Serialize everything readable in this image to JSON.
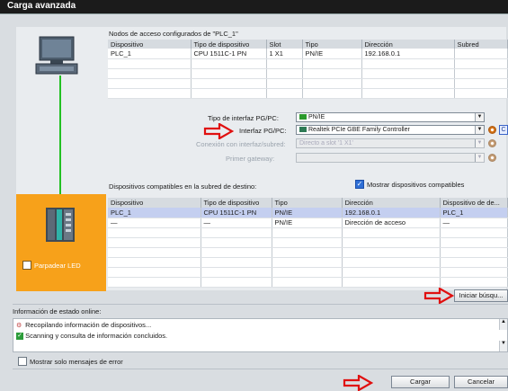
{
  "window": {
    "title": "Carga avanzada"
  },
  "configured": {
    "caption": "Nodos de acceso configurados de \"PLC_1\"",
    "columns": [
      "Dispositivo",
      "Tipo de dispositivo",
      "Slot",
      "Tipo",
      "Dirección",
      "Subred"
    ],
    "rows": [
      [
        "PLC_1",
        "CPU 1511C-1 PN",
        "1 X1",
        "PN/IE",
        "192.168.0.1",
        ""
      ]
    ]
  },
  "interface": {
    "type_label": "Tipo de interfaz PG/PC:",
    "type_value": "PN/IE",
    "iface_label": "Interfaz PG/PC:",
    "iface_value": "Realtek PCIe GBE Family Controller",
    "iface_extra": "C",
    "conn_label": "Conexión con interfaz/subred:",
    "conn_value": "Directo a slot '1 X1'",
    "gateway_label": "Primer gateway:",
    "gateway_value": ""
  },
  "compatible": {
    "caption": "Dispositivos compatibles en la subred de destino:",
    "show_all_label": "Mostrar dispositivos compatibles",
    "show_all_checked": true,
    "columns": [
      "Dispositivo",
      "Tipo de dispositivo",
      "Tipo",
      "Dirección",
      "Dispositivo de de..."
    ],
    "rows": [
      [
        "PLC_1",
        "CPU 1511C-1 PN",
        "PN/IE",
        "192.168.0.1",
        "PLC_1"
      ],
      [
        "—",
        "—",
        "PN/IE",
        "Dirección de acceso",
        "—"
      ]
    ]
  },
  "flash_led_label": "Parpadear LED",
  "search_button": "Iniciar búsqu...",
  "status": {
    "heading": "Información de estado online:",
    "lines": [
      {
        "icon": "gear-icon",
        "text": "Recopilando información de dispositivos..."
      },
      {
        "icon": "check-icon",
        "text": "Scanning y consulta de información concluidos."
      }
    ]
  },
  "errors_only_label": "Mostrar solo mensajes de error",
  "buttons": {
    "load": "Cargar",
    "cancel": "Cancelar"
  },
  "colors": {
    "accent_orange": "#f7a11a",
    "arrow_red": "#e01010",
    "link_green": "#22c022"
  }
}
